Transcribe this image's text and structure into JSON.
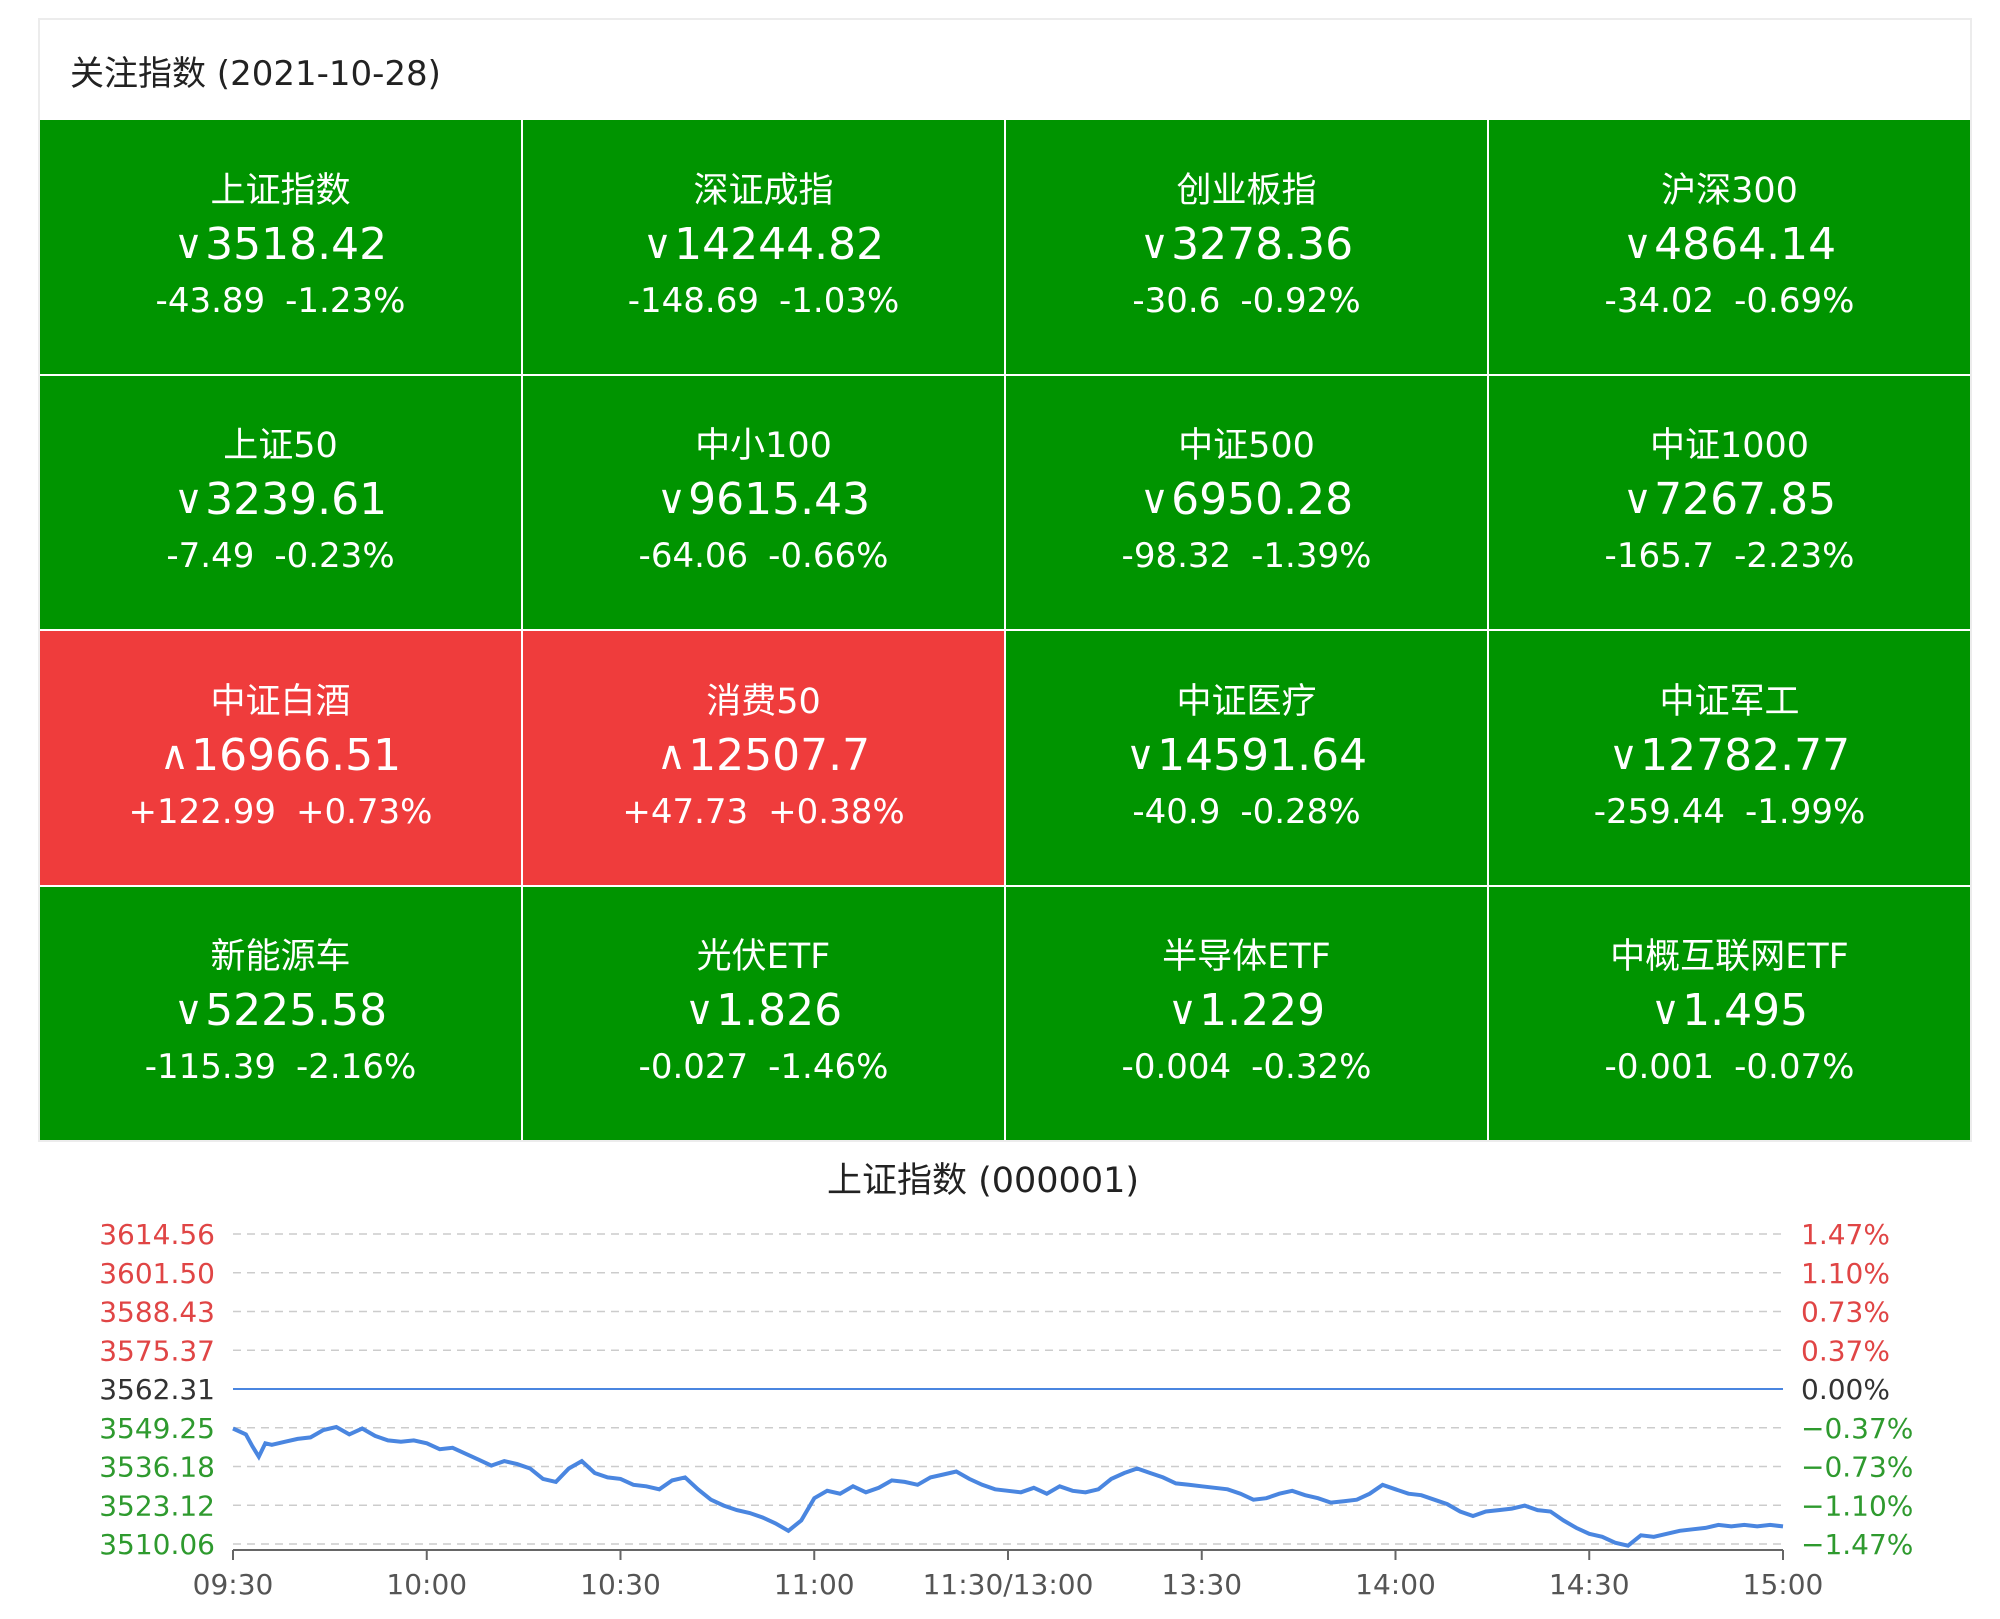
{
  "header": {
    "title": "关注指数 (2021-10-28)"
  },
  "indices": [
    {
      "name": "上证指数",
      "direction": "down",
      "arrow": "∨",
      "price": "3518.42",
      "change": "-43.89",
      "pct": "-1.23%"
    },
    {
      "name": "深证成指",
      "direction": "down",
      "arrow": "∨",
      "price": "14244.82",
      "change": "-148.69",
      "pct": "-1.03%"
    },
    {
      "name": "创业板指",
      "direction": "down",
      "arrow": "∨",
      "price": "3278.36",
      "change": "-30.6",
      "pct": "-0.92%"
    },
    {
      "name": "沪深300",
      "direction": "down",
      "arrow": "∨",
      "price": "4864.14",
      "change": "-34.02",
      "pct": "-0.69%"
    },
    {
      "name": "上证50",
      "direction": "down",
      "arrow": "∨",
      "price": "3239.61",
      "change": "-7.49",
      "pct": "-0.23%"
    },
    {
      "name": "中小100",
      "direction": "down",
      "arrow": "∨",
      "price": "9615.43",
      "change": "-64.06",
      "pct": "-0.66%"
    },
    {
      "name": "中证500",
      "direction": "down",
      "arrow": "∨",
      "price": "6950.28",
      "change": "-98.32",
      "pct": "-1.39%"
    },
    {
      "name": "中证1000",
      "direction": "down",
      "arrow": "∨",
      "price": "7267.85",
      "change": "-165.7",
      "pct": "-2.23%"
    },
    {
      "name": "中证白酒",
      "direction": "up",
      "arrow": "∧",
      "price": "16966.51",
      "change": "+122.99",
      "pct": "+0.73%"
    },
    {
      "name": "消费50",
      "direction": "up",
      "arrow": "∧",
      "price": "12507.7",
      "change": "+47.73",
      "pct": "+0.38%"
    },
    {
      "name": "中证医疗",
      "direction": "down",
      "arrow": "∨",
      "price": "14591.64",
      "change": "-40.9",
      "pct": "-0.28%"
    },
    {
      "name": "中证军工",
      "direction": "down",
      "arrow": "∨",
      "price": "12782.77",
      "change": "-259.44",
      "pct": "-1.99%"
    },
    {
      "name": "新能源车",
      "direction": "down",
      "arrow": "∨",
      "price": "5225.58",
      "change": "-115.39",
      "pct": "-2.16%"
    },
    {
      "name": "光伏ETF",
      "direction": "down",
      "arrow": "∨",
      "price": "1.826",
      "change": "-0.027",
      "pct": "-1.46%"
    },
    {
      "name": "半导体ETF",
      "direction": "down",
      "arrow": "∨",
      "price": "1.229",
      "change": "-0.004",
      "pct": "-0.32%"
    },
    {
      "name": "中概互联网ETF",
      "direction": "down",
      "arrow": "∨",
      "price": "1.495",
      "change": "-0.001",
      "pct": "-0.07%"
    }
  ],
  "colors": {
    "down_bg": "#009400",
    "up_bg": "#ef3c3c",
    "line": "#4a86e0",
    "axis_up": "#e04545",
    "axis_down": "#2e9a2e",
    "axis_neutral": "#333333",
    "grid": "#cccccc"
  },
  "chart_data": {
    "type": "line",
    "title": "上证指数 (000001)",
    "prev_close": 3562.31,
    "ylim": [
      3510.06,
      3614.56
    ],
    "y_ticks_left": [
      "3614.56",
      "3601.50",
      "3588.43",
      "3575.37",
      "3562.31",
      "3549.25",
      "3536.18",
      "3523.12",
      "3510.06"
    ],
    "y_ticks_right": [
      "1.47%",
      "1.10%",
      "0.73%",
      "0.37%",
      "0.00%",
      "−0.37%",
      "−0.73%",
      "−1.10%",
      "−1.47%"
    ],
    "x_ticks": [
      "09:30",
      "10:00",
      "10:30",
      "11:00",
      "11:30/13:00",
      "13:30",
      "14:00",
      "14:30",
      "15:00"
    ],
    "x_range_minutes": [
      0,
      240
    ],
    "grid": true,
    "series": [
      {
        "x": [
          0,
          2,
          3,
          4,
          5,
          6,
          8,
          10,
          12,
          14,
          16,
          18,
          20,
          22,
          24,
          26,
          28,
          30,
          32,
          34,
          36,
          38,
          40,
          42,
          44,
          46,
          48,
          50,
          52,
          54,
          56,
          58,
          60,
          62,
          64,
          66,
          68,
          70,
          72,
          74,
          76,
          78,
          80,
          82,
          84,
          86,
          88,
          90,
          92,
          94,
          96,
          98,
          100,
          102,
          104,
          106,
          108,
          110,
          112,
          114,
          116,
          118,
          120,
          122,
          124,
          126,
          128,
          130,
          132,
          134,
          136,
          138,
          140,
          142,
          144,
          146,
          148,
          150,
          152,
          154,
          156,
          158,
          160,
          162,
          164,
          166,
          168,
          170,
          172,
          174,
          176,
          178,
          180,
          182,
          184,
          186,
          188,
          190,
          192,
          194,
          196,
          198,
          200,
          202,
          204,
          206,
          208,
          210,
          212,
          214,
          216,
          218,
          220,
          222,
          224,
          226,
          228,
          230,
          232,
          234,
          236,
          238,
          240
        ],
        "y": [
          3549.0,
          3547.0,
          3543.0,
          3539.5,
          3544.0,
          3543.5,
          3544.5,
          3545.5,
          3546.0,
          3548.5,
          3549.5,
          3547.0,
          3549.0,
          3546.5,
          3545.0,
          3544.5,
          3545.0,
          3544.0,
          3542.0,
          3542.5,
          3540.5,
          3538.5,
          3536.5,
          3538.0,
          3537.0,
          3535.5,
          3532.0,
          3531.0,
          3535.5,
          3538.0,
          3534.0,
          3532.5,
          3532.0,
          3530.0,
          3529.5,
          3528.5,
          3531.5,
          3532.5,
          3528.5,
          3525.0,
          3523.0,
          3521.5,
          3520.5,
          3519.0,
          3517.0,
          3514.5,
          3518.0,
          3525.5,
          3528.0,
          3527.0,
          3529.5,
          3527.5,
          3529.0,
          3531.5,
          3531.0,
          3530.0,
          3532.5,
          3533.5,
          3534.5,
          3532.0,
          3530.0,
          3528.5,
          3528.0,
          3527.5,
          3529.0,
          3527.0,
          3529.5,
          3528.0,
          3527.5,
          3528.5,
          3532.0,
          3534.0,
          3535.5,
          3534.0,
          3532.5,
          3530.5,
          3530.0,
          3529.5,
          3529.0,
          3528.5,
          3527.0,
          3525.0,
          3525.5,
          3527.0,
          3528.0,
          3526.5,
          3525.5,
          3524.0,
          3524.5,
          3525.0,
          3527.0,
          3530.0,
          3528.5,
          3527.0,
          3526.5,
          3525.0,
          3523.5,
          3521.0,
          3519.5,
          3521.0,
          3521.5,
          3522.0,
          3523.0,
          3521.5,
          3521.0,
          3518.0,
          3515.5,
          3513.5,
          3512.5,
          3510.5,
          3509.5,
          3513.0,
          3512.5,
          3513.5,
          3514.5,
          3515.0,
          3515.5,
          3516.5,
          3516.0,
          3516.5,
          3516.0,
          3516.5,
          3516.0
        ]
      }
    ]
  }
}
